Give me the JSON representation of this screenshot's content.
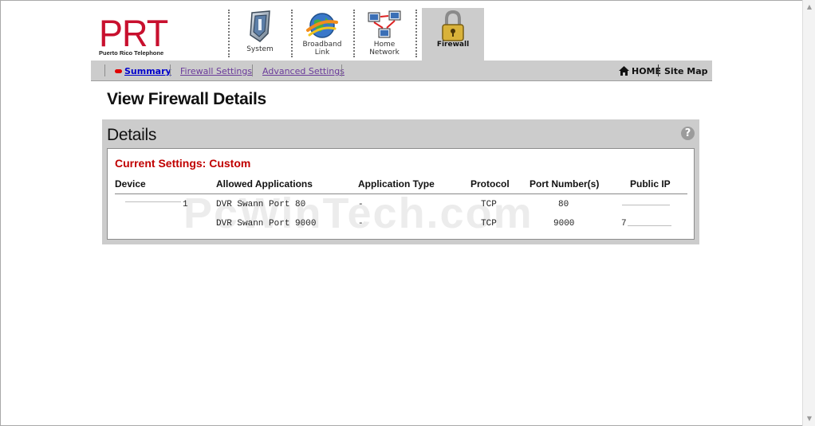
{
  "logo": {
    "mark": "PRT",
    "subtitle": "Puerto Rico Telephone"
  },
  "tabs": [
    {
      "label_line1": "System",
      "label_line2": "",
      "icon": "system-icon"
    },
    {
      "label_line1": "Broadband",
      "label_line2": "Link",
      "icon": "broadband-globe-icon"
    },
    {
      "label_line1": "Home",
      "label_line2": "Network",
      "icon": "home-network-icon"
    },
    {
      "label_line1": "Firewall",
      "label_line2": "",
      "icon": "padlock-icon",
      "active": true
    }
  ],
  "subnav": {
    "items": [
      "Summary",
      "Firewall Settings",
      "Advanced Settings"
    ],
    "home": "HOME",
    "sitemap": "Site Map"
  },
  "page_title": "View Firewall Details",
  "panel": {
    "title": "Details",
    "help": "?",
    "current_settings": "Current Settings: Custom",
    "columns": [
      "Device",
      "Allowed Applications",
      "Application Type",
      "Protocol",
      "Port Number(s)",
      "Public IP"
    ],
    "rows": [
      {
        "device": "1",
        "application": "DVR Swann Port 80",
        "type": "-",
        "protocol": "TCP",
        "ports": "80",
        "public_ip": ""
      },
      {
        "device": "",
        "application": "DVR Swann Port 9000",
        "type": "-",
        "protocol": "TCP",
        "ports": "9000",
        "public_ip": "7"
      }
    ]
  },
  "watermark": "PcWinTech.com",
  "colors": {
    "brand": "#c8102e",
    "panel_bg": "#cccccc",
    "link": "#0000cc",
    "visited": "#6a3a9a",
    "alert": "#c00000"
  }
}
